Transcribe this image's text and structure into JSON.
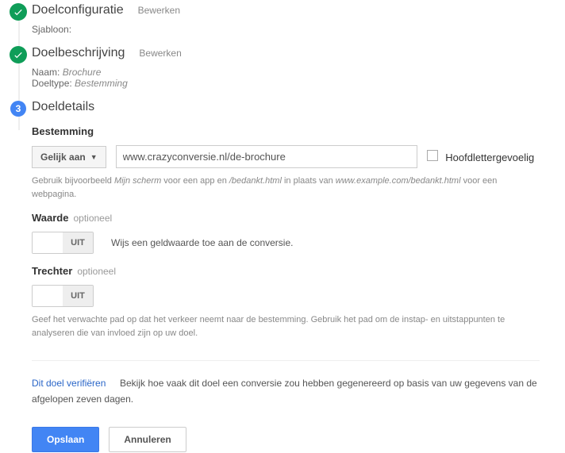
{
  "step1": {
    "title": "Doelconfiguratie",
    "edit": "Bewerken",
    "template_label": "Sjabloon:",
    "template_value": ""
  },
  "step2": {
    "title": "Doelbeschrijving",
    "edit": "Bewerken",
    "name_label": "Naam:",
    "name_value": "Brochure",
    "type_label": "Doeltype:",
    "type_value": "Bestemming"
  },
  "step3": {
    "number": "3",
    "title": "Doeldetails",
    "destination": {
      "label": "Bestemming",
      "match_type": "Gelijk aan",
      "value": "www.crazyconversie.nl/de-brochure",
      "case_sensitive": "Hoofdlettergevoelig",
      "hint_1": "Gebruik bijvoorbeeld ",
      "hint_i1": "Mijn scherm",
      "hint_2": " voor een app en ",
      "hint_i2": "/bedankt.html",
      "hint_3": " in plaats van ",
      "hint_i3": "www.example.com/bedankt.html",
      "hint_4": " voor een webpagina."
    },
    "value": {
      "label": "Waarde",
      "optional": "optioneel",
      "toggle": "UIT",
      "desc": "Wijs een geldwaarde toe aan de conversie."
    },
    "funnel": {
      "label": "Trechter",
      "optional": "optioneel",
      "toggle": "UIT",
      "hint": "Geef het verwachte pad op dat het verkeer neemt naar de bestemming. Gebruik het pad om de instap- en uitstappunten te analyseren die van invloed zijn op uw doel."
    },
    "verify": {
      "link": "Dit doel verifiëren",
      "text": "Bekijk hoe vaak dit doel een conversie zou hebben gegenereerd op basis van uw gegevens van de afgelopen zeven dagen."
    },
    "buttons": {
      "save": "Opslaan",
      "cancel": "Annuleren"
    }
  }
}
